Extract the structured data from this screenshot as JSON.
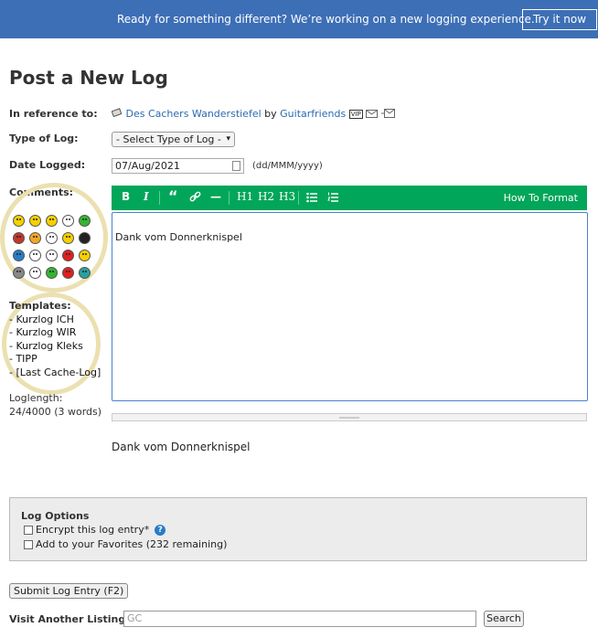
{
  "banner": {
    "text": "Ready for something different? We’re working on a new logging experience.",
    "button": "Try it now",
    "bg_color": "#3d6fb6"
  },
  "page": {
    "title": "Post a New Log"
  },
  "form": {
    "reference_label": "In reference to:",
    "cache_name": "Des Cachers Wanderstiefel",
    "by_text": "by",
    "owner": "Guitarfriends",
    "owner_badges": [
      "VIP"
    ],
    "log_type_label": "Type of Log:",
    "log_type_value": "- Select Type of Log -",
    "date_label": "Date Logged:",
    "date_value": "07/Aug/2021",
    "date_hint": "(dd/MMM/yyyy)",
    "comments_label": "Comments:"
  },
  "templates": {
    "title": "Templates:",
    "items": [
      "- Kurzlog ICH",
      "- Kurzlog WIR",
      "- Kurzlog Kleks",
      "- TIPP",
      "- [Last Cache-Log]"
    ]
  },
  "loglength": {
    "label": "Loglength:",
    "value": "24/4000 (3 words)"
  },
  "toolbar": {
    "buttons": [
      "B",
      "I",
      "“",
      "link-icon",
      "—",
      "H1",
      "H2",
      "H3",
      "bullet-list-icon",
      "numbered-list-icon"
    ],
    "how_to": "How To Format",
    "color": "#02a65a"
  },
  "editor": {
    "value": "Dank vom Donnerknispel"
  },
  "preview": {
    "text": "Dank vom Donnerknispel"
  },
  "options": {
    "title": "Log Options",
    "encrypt": "Encrypt this log entry*",
    "favorites": "Add to your Favorites (232 remaining)"
  },
  "submit": {
    "label": "Submit Log Entry (F2)"
  },
  "visit": {
    "label": "Visit Another Listing:",
    "placeholder": "GC",
    "button": "Search"
  },
  "smiley_colors": [
    "#f5d000",
    "#f5d000",
    "#f5d000",
    "#ffffff",
    "#34b530",
    "#c0392b",
    "#f5a623",
    "#ffffff",
    "#f5d000",
    "#222222",
    "#2a7cc7",
    "#ffffff",
    "#ffffff",
    "#e02020",
    "#f5d000",
    "#888888",
    "#ffffff",
    "#34b530",
    "#e02020",
    "#2aa0a0"
  ]
}
